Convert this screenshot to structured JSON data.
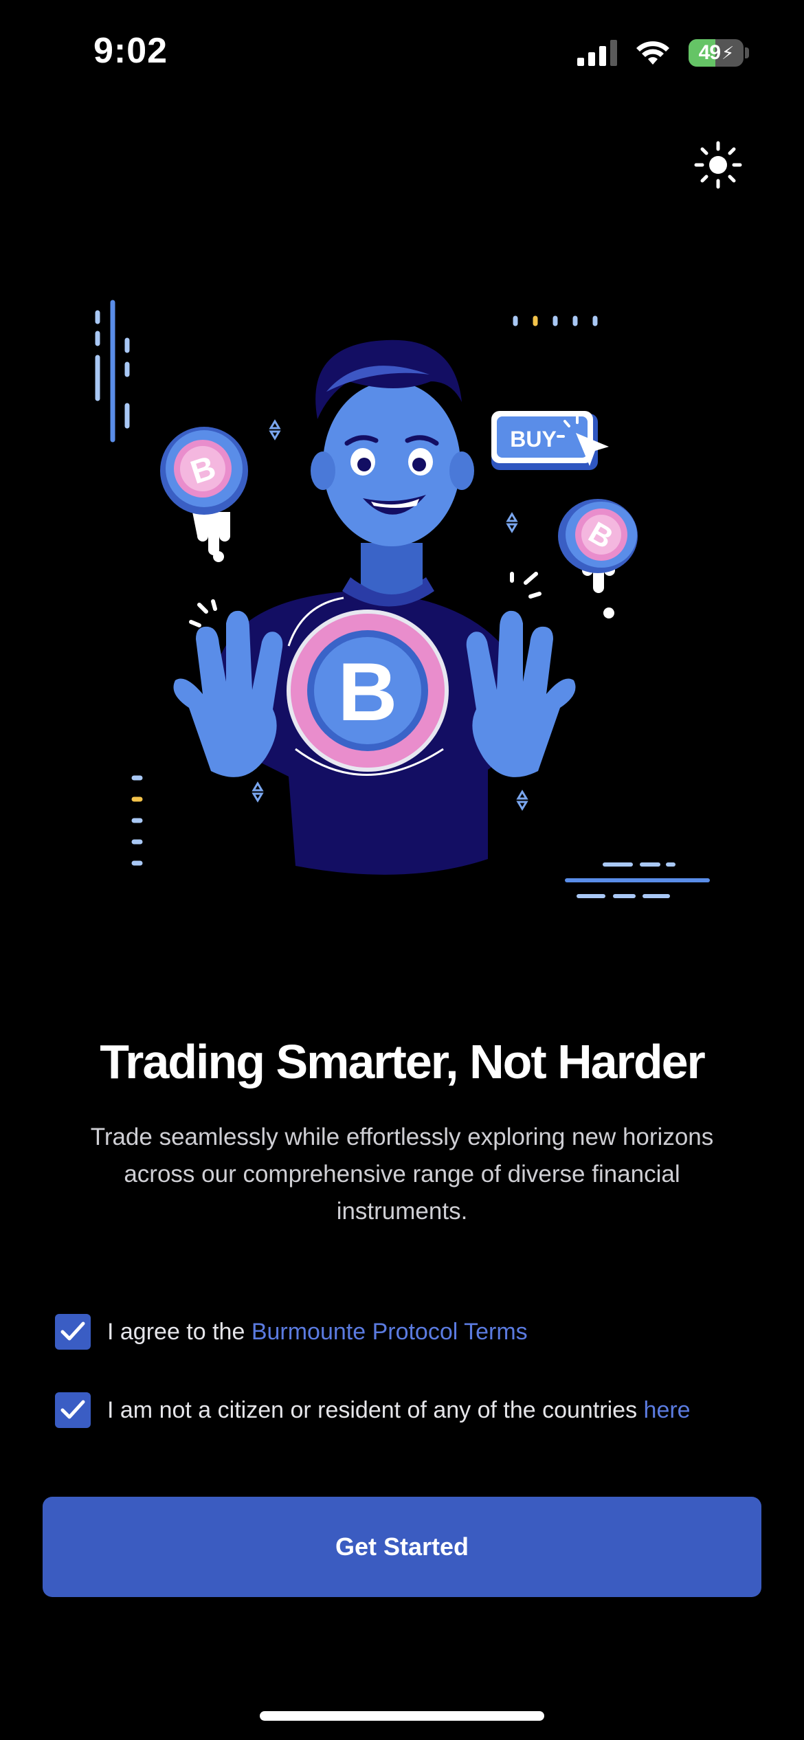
{
  "status_bar": {
    "time": "9:02",
    "battery_percent": "49",
    "battery_level": 0.49
  },
  "icons": {
    "theme_toggle": "sun-icon",
    "checkbox": "checkmark-icon"
  },
  "illustration": {
    "button_text": "BUY",
    "coin_symbol": "B"
  },
  "onboarding": {
    "title": "Trading Smarter, Not Harder",
    "subtitle": "Trade seamlessly while effortlessly exploring new horizons across our comprehensive range of diverse financial instruments."
  },
  "agreements": [
    {
      "text": "I agree to the ",
      "link": "Burmounte Protocol Terms",
      "checked": true
    },
    {
      "text": "I am not a citizen or resident of any of the countries ",
      "link": "here",
      "checked": true
    }
  ],
  "cta": {
    "label": "Get Started"
  },
  "colors": {
    "accent": "#3b5cc1",
    "link": "#5b7be0",
    "background": "#000000"
  }
}
